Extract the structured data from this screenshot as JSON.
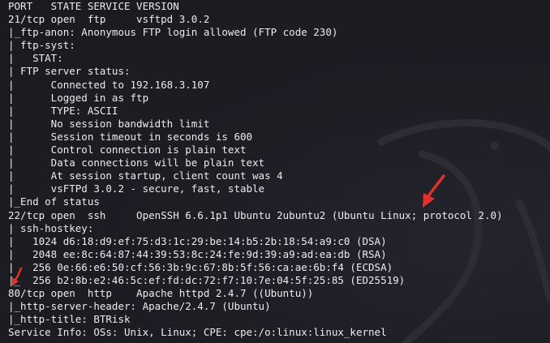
{
  "terminal": {
    "lines": [
      "PORT   STATE SERVICE VERSION",
      "21/tcp open  ftp     vsftpd 3.0.2",
      "|_ftp-anon: Anonymous FTP login allowed (FTP code 230)",
      "| ftp-syst:",
      "|   STAT:",
      "| FTP server status:",
      "|      Connected to 192.168.3.107",
      "|      Logged in as ftp",
      "|      TYPE: ASCII",
      "|      No session bandwidth limit",
      "|      Session timeout in seconds is 600",
      "|      Control connection is plain text",
      "|      Data connections will be plain text",
      "|      At session startup, client count was 4",
      "|      vsFTPd 3.0.2 - secure, fast, stable",
      "|_End of status",
      "22/tcp open  ssh     OpenSSH 6.6.1p1 Ubuntu 2ubuntu2 (Ubuntu Linux; protocol 2.0)",
      "| ssh-hostkey:",
      "|   1024 d6:18:d9:ef:75:d3:1c:29:be:14:b5:2b:18:54:a9:c0 (DSA)",
      "|   2048 ee:8c:64:87:44:39:53:8c:24:fe:9d:39:a9:ad:ea:db (RSA)",
      "|   256 0e:66:e6:50:cf:56:3b:9c:67:8b:5f:56:ca:ae:6b:f4 (ECDSA)",
      "|_  256 b2:8b:e2:46:5c:ef:fd:dc:72:f7:10:7e:04:5f:25:85 (ED25519)",
      "80/tcp open  http    Apache httpd 2.4.7 ((Ubuntu))",
      "|_http-server-header: Apache/2.4.7 (Ubuntu)",
      "|_http-title: BTRisk",
      "Service Info: OSs: Unix, Linux; CPE: cpe:/o:linux:linux_kernel"
    ]
  },
  "colors": {
    "background": "#1b1b22",
    "text": "#ececec",
    "annotation_arrow": "#e0312b"
  }
}
